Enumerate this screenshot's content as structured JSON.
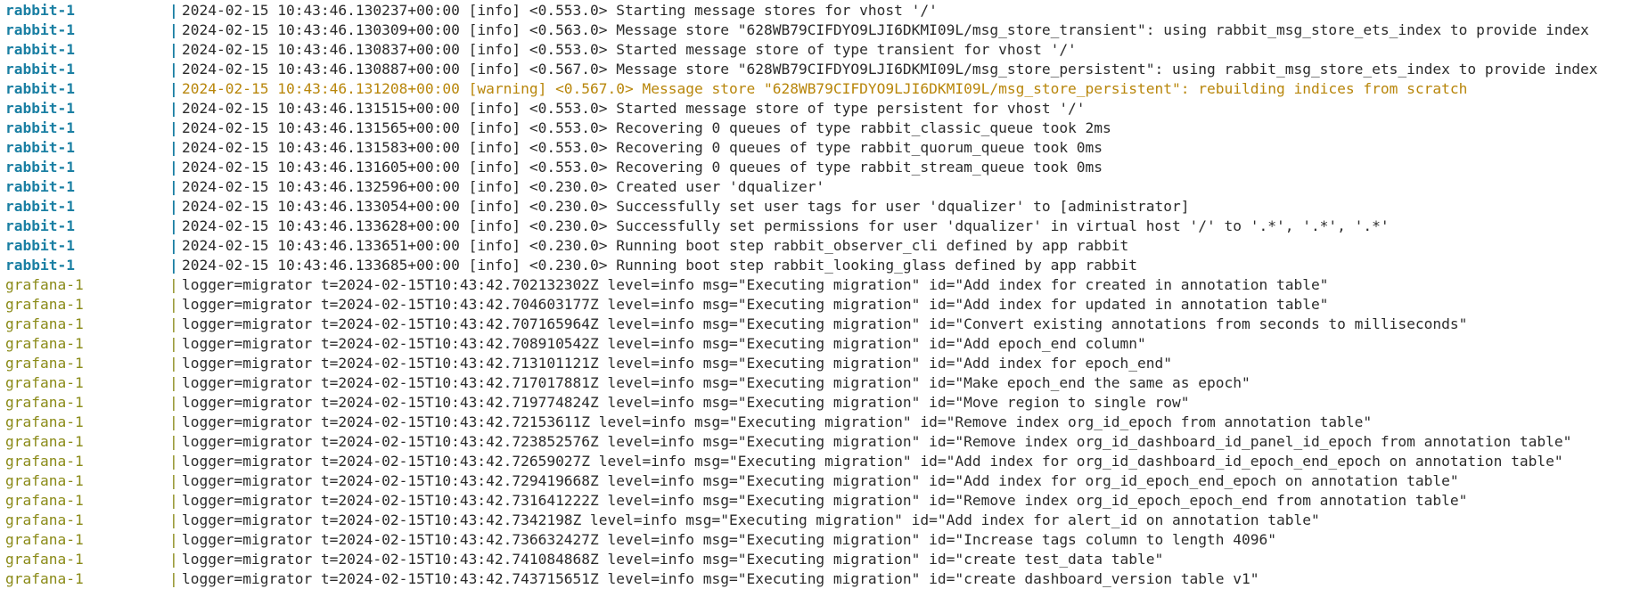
{
  "separator": "|",
  "colors": {
    "rabbit": "#1a7fa3",
    "grafana": "#8a8a17",
    "warning": "#b8860b",
    "text": "#2b2b2b",
    "background": "#ffffff"
  },
  "lines": [
    {
      "service": "rabbit-1",
      "message": "2024-02-15 10:43:46.130237+00:00 [info] <0.553.0> Starting message stores for vhost '/'"
    },
    {
      "service": "rabbit-1",
      "message": "2024-02-15 10:43:46.130309+00:00 [info] <0.563.0> Message store \"628WB79CIFDYO9LJI6DKMI09L/msg_store_transient\": using rabbit_msg_store_ets_index to provide index"
    },
    {
      "service": "rabbit-1",
      "message": "2024-02-15 10:43:46.130837+00:00 [info] <0.553.0> Started message store of type transient for vhost '/'"
    },
    {
      "service": "rabbit-1",
      "message": "2024-02-15 10:43:46.130887+00:00 [info] <0.567.0> Message store \"628WB79CIFDYO9LJI6DKMI09L/msg_store_persistent\": using rabbit_msg_store_ets_index to provide index"
    },
    {
      "service": "rabbit-1",
      "message": "2024-02-15 10:43:46.131208+00:00 [warning] <0.567.0> Message store \"628WB79CIFDYO9LJI6DKMI09L/msg_store_persistent\": rebuilding indices from scratch",
      "level": "warning"
    },
    {
      "service": "rabbit-1",
      "message": "2024-02-15 10:43:46.131515+00:00 [info] <0.553.0> Started message store of type persistent for vhost '/'"
    },
    {
      "service": "rabbit-1",
      "message": "2024-02-15 10:43:46.131565+00:00 [info] <0.553.0> Recovering 0 queues of type rabbit_classic_queue took 2ms"
    },
    {
      "service": "rabbit-1",
      "message": "2024-02-15 10:43:46.131583+00:00 [info] <0.553.0> Recovering 0 queues of type rabbit_quorum_queue took 0ms"
    },
    {
      "service": "rabbit-1",
      "message": "2024-02-15 10:43:46.131605+00:00 [info] <0.553.0> Recovering 0 queues of type rabbit_stream_queue took 0ms"
    },
    {
      "service": "rabbit-1",
      "message": "2024-02-15 10:43:46.132596+00:00 [info] <0.230.0> Created user 'dqualizer'"
    },
    {
      "service": "rabbit-1",
      "message": "2024-02-15 10:43:46.133054+00:00 [info] <0.230.0> Successfully set user tags for user 'dqualizer' to [administrator]"
    },
    {
      "service": "rabbit-1",
      "message": "2024-02-15 10:43:46.133628+00:00 [info] <0.230.0> Successfully set permissions for user 'dqualizer' in virtual host '/' to '.*', '.*', '.*'"
    },
    {
      "service": "rabbit-1",
      "message": "2024-02-15 10:43:46.133651+00:00 [info] <0.230.0> Running boot step rabbit_observer_cli defined by app rabbit"
    },
    {
      "service": "rabbit-1",
      "message": "2024-02-15 10:43:46.133685+00:00 [info] <0.230.0> Running boot step rabbit_looking_glass defined by app rabbit"
    },
    {
      "service": "grafana-1",
      "message": "logger=migrator t=2024-02-15T10:43:42.702132302Z level=info msg=\"Executing migration\" id=\"Add index for created in annotation table\""
    },
    {
      "service": "grafana-1",
      "message": "logger=migrator t=2024-02-15T10:43:42.704603177Z level=info msg=\"Executing migration\" id=\"Add index for updated in annotation table\""
    },
    {
      "service": "grafana-1",
      "message": "logger=migrator t=2024-02-15T10:43:42.707165964Z level=info msg=\"Executing migration\" id=\"Convert existing annotations from seconds to milliseconds\""
    },
    {
      "service": "grafana-1",
      "message": "logger=migrator t=2024-02-15T10:43:42.708910542Z level=info msg=\"Executing migration\" id=\"Add epoch_end column\""
    },
    {
      "service": "grafana-1",
      "message": "logger=migrator t=2024-02-15T10:43:42.713101121Z level=info msg=\"Executing migration\" id=\"Add index for epoch_end\""
    },
    {
      "service": "grafana-1",
      "message": "logger=migrator t=2024-02-15T10:43:42.717017881Z level=info msg=\"Executing migration\" id=\"Make epoch_end the same as epoch\""
    },
    {
      "service": "grafana-1",
      "message": "logger=migrator t=2024-02-15T10:43:42.719774824Z level=info msg=\"Executing migration\" id=\"Move region to single row\""
    },
    {
      "service": "grafana-1",
      "message": "logger=migrator t=2024-02-15T10:43:42.72153611Z level=info msg=\"Executing migration\" id=\"Remove index org_id_epoch from annotation table\""
    },
    {
      "service": "grafana-1",
      "message": "logger=migrator t=2024-02-15T10:43:42.723852576Z level=info msg=\"Executing migration\" id=\"Remove index org_id_dashboard_id_panel_id_epoch from annotation table\""
    },
    {
      "service": "grafana-1",
      "message": "logger=migrator t=2024-02-15T10:43:42.72659027Z level=info msg=\"Executing migration\" id=\"Add index for org_id_dashboard_id_epoch_end_epoch on annotation table\""
    },
    {
      "service": "grafana-1",
      "message": "logger=migrator t=2024-02-15T10:43:42.729419668Z level=info msg=\"Executing migration\" id=\"Add index for org_id_epoch_end_epoch on annotation table\""
    },
    {
      "service": "grafana-1",
      "message": "logger=migrator t=2024-02-15T10:43:42.731641222Z level=info msg=\"Executing migration\" id=\"Remove index org_id_epoch_epoch_end from annotation table\""
    },
    {
      "service": "grafana-1",
      "message": "logger=migrator t=2024-02-15T10:43:42.7342198Z level=info msg=\"Executing migration\" id=\"Add index for alert_id on annotation table\""
    },
    {
      "service": "grafana-1",
      "message": "logger=migrator t=2024-02-15T10:43:42.736632427Z level=info msg=\"Executing migration\" id=\"Increase tags column to length 4096\""
    },
    {
      "service": "grafana-1",
      "message": "logger=migrator t=2024-02-15T10:43:42.741084868Z level=info msg=\"Executing migration\" id=\"create test_data table\""
    },
    {
      "service": "grafana-1",
      "message": "logger=migrator t=2024-02-15T10:43:42.743715651Z level=info msg=\"Executing migration\" id=\"create dashboard_version table v1\""
    }
  ]
}
